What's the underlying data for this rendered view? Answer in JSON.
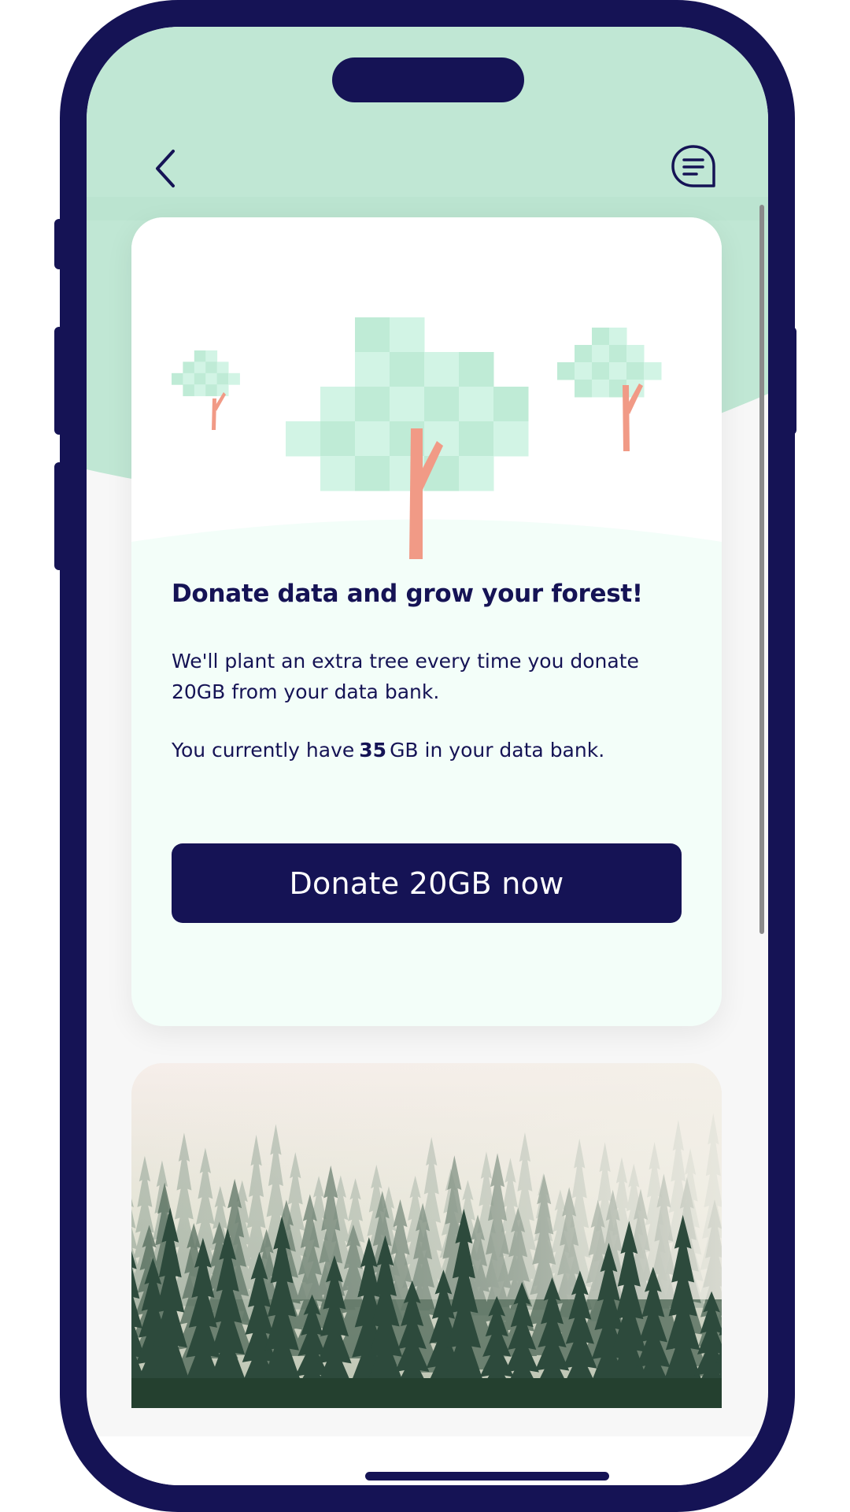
{
  "colors": {
    "brand_navy": "#151355",
    "header_mint": "#c0e7d4",
    "card_mint": "#f3fef9",
    "leaf_light": "#d2f4e5",
    "leaf_dark": "#bfebd6",
    "trunk_salmon": "#f19a86",
    "screen_bg": "#f7f7f7"
  },
  "header": {
    "back_icon": "chevron-left-icon",
    "chat_icon": "chat-bubble-icon"
  },
  "promo_card": {
    "illustration_icon": "pixel-trees-icon",
    "title": "Donate data and grow your forest!",
    "description": "We'll plant an extra tree every time you donate 20GB from your data bank.",
    "balance_prefix": "You currently have",
    "balance_amount": "35",
    "balance_suffix": "GB in your data bank.",
    "donate_button_label": "Donate 20GB now"
  },
  "forest_photo": {
    "subject": "misty pine forest"
  }
}
